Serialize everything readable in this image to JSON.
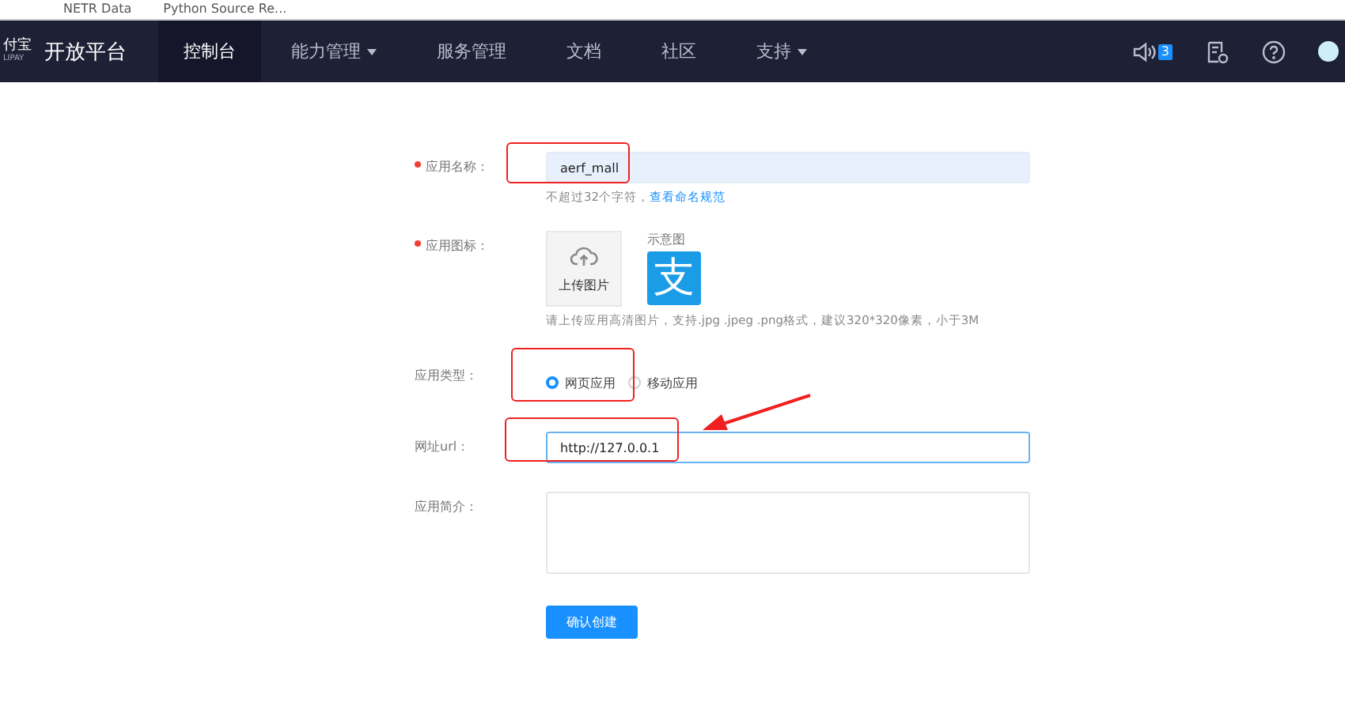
{
  "bookmarks": [
    "NETR Data",
    "Python Source Re..."
  ],
  "brand": {
    "logo_text": "付宝",
    "logo_sub": "LIPAY",
    "title": "开放平台"
  },
  "nav": [
    {
      "label": "控制台",
      "selected": true,
      "dropdown": false
    },
    {
      "label": "能力管理",
      "selected": false,
      "dropdown": true
    },
    {
      "label": "服务管理",
      "selected": false,
      "dropdown": false
    },
    {
      "label": "文档",
      "selected": false,
      "dropdown": false
    },
    {
      "label": "社区",
      "selected": false,
      "dropdown": false
    },
    {
      "label": "支持",
      "selected": false,
      "dropdown": true
    }
  ],
  "header_icons": {
    "notification_count": "3"
  },
  "form": {
    "name": {
      "label": "应用名称：",
      "required": true,
      "value": "aerf_mall",
      "hint": "不超过32个字符，",
      "hint_link": "查看命名规范"
    },
    "icon": {
      "label": "应用图标：",
      "required": true,
      "upload": "上传图片",
      "sample_label": "示意图",
      "sample_glyph": "支",
      "hint": "请上传应用高清图片，支持.jpg .jpeg .png格式，建议320*320像素，小于3M"
    },
    "type": {
      "label": "应用类型：",
      "options": [
        {
          "label": "网页应用",
          "selected": true
        },
        {
          "label": "移动应用",
          "selected": false
        }
      ]
    },
    "url": {
      "label": "网址url：",
      "value": "http://127.0.0.1"
    },
    "intro": {
      "label": "应用简介："
    },
    "submit": "确认创建"
  }
}
